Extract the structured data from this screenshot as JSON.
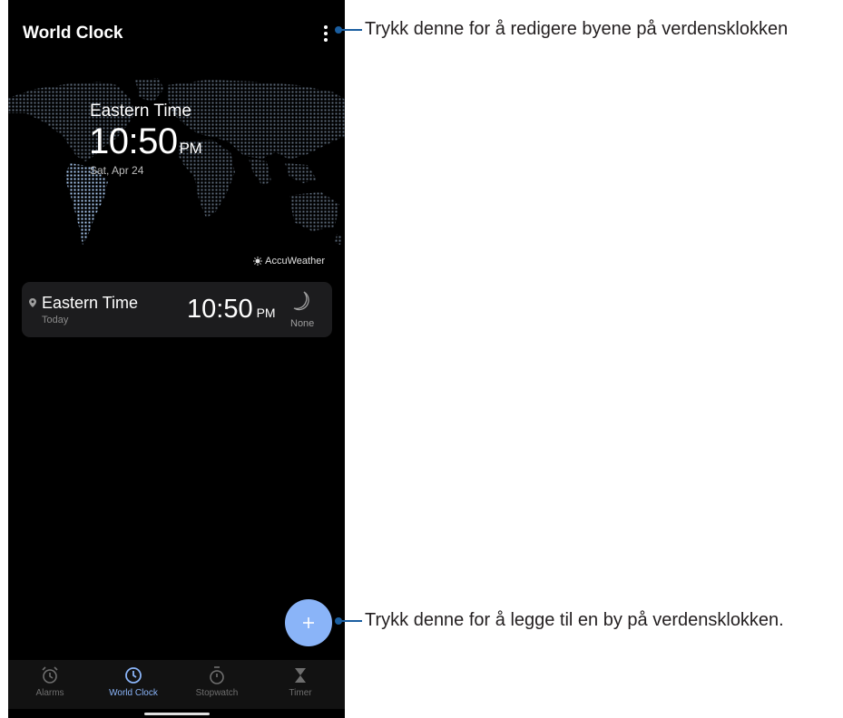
{
  "app": {
    "title": "World Clock"
  },
  "hero": {
    "city": "Eastern Time",
    "time": "10:50",
    "ampm": "PM",
    "date": "Sat, Apr 24",
    "provider": "AccuWeather"
  },
  "cities": [
    {
      "name": "Eastern Time",
      "day": "Today",
      "time": "10:50",
      "ampm": "PM",
      "weather": "None",
      "weather_icon": "moon-icon"
    }
  ],
  "tabs": [
    {
      "label": "Alarms",
      "icon": "alarm-icon",
      "active": false
    },
    {
      "label": "World Clock",
      "icon": "clock-icon",
      "active": true
    },
    {
      "label": "Stopwatch",
      "icon": "stopwatch-icon",
      "active": false
    },
    {
      "label": "Timer",
      "icon": "hourglass-icon",
      "active": false
    }
  ],
  "annotations": {
    "menu": "Trykk denne for å redigere byene på verdensklokken",
    "add": "Trykk denne for å legge til en by på verdensklokken."
  },
  "colors": {
    "accent": "#8ab4f8",
    "background": "#000000",
    "card": "#1c1c1e",
    "callout_line": "#1a5ea0"
  }
}
